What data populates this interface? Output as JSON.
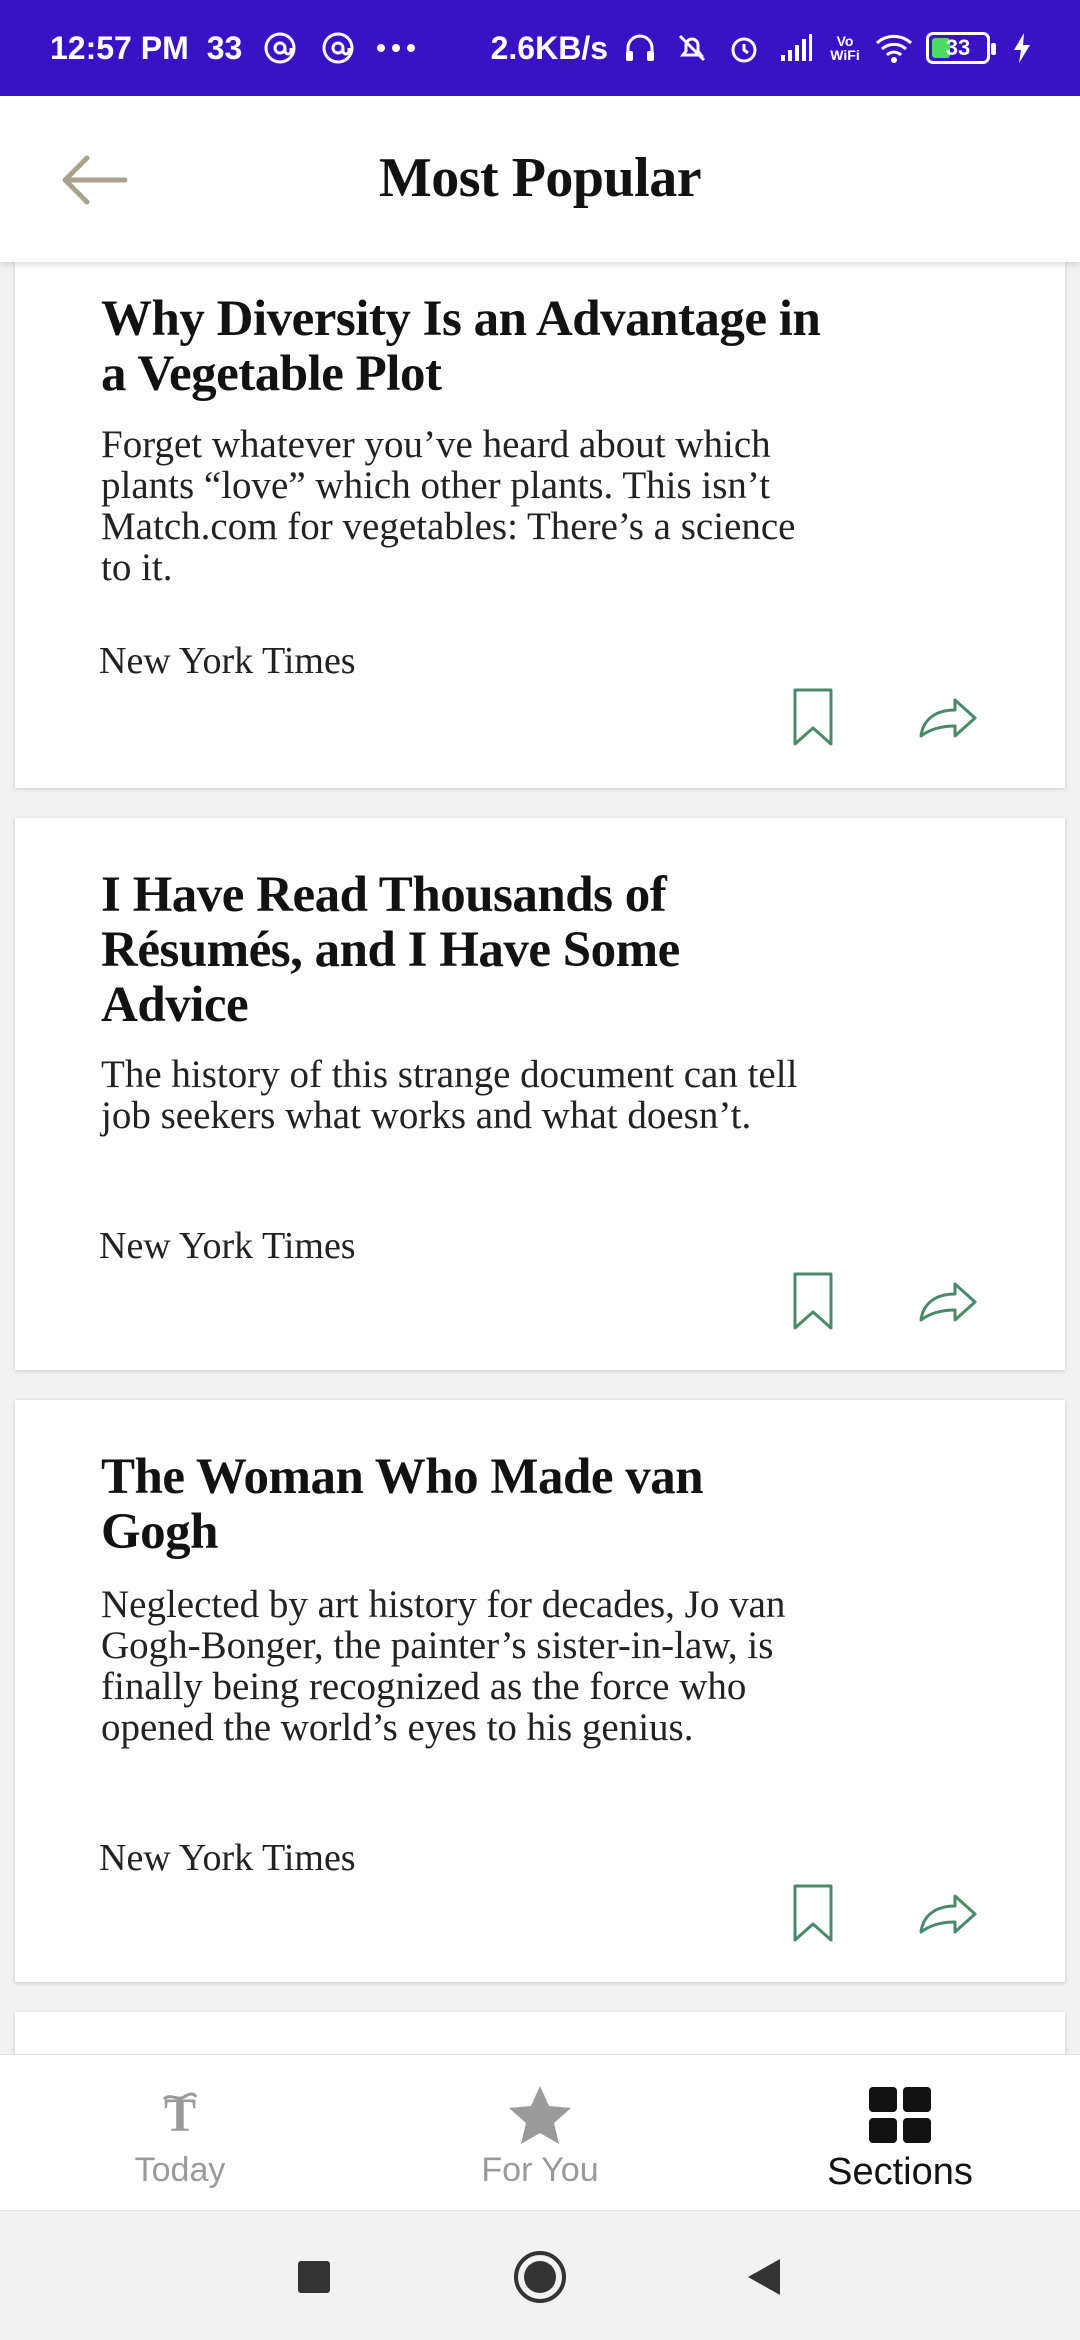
{
  "status_bar": {
    "time": "12:57 PM",
    "notif_count": "33",
    "speed": "2.6KB/s",
    "battery": "33",
    "icons": [
      "at-icon",
      "at-icon",
      "more-icon",
      "headphones-icon",
      "bell-off-icon",
      "alarm-icon",
      "signal-icon",
      "vowifi-icon",
      "wifi-icon",
      "battery-icon",
      "charging-icon"
    ],
    "vowifi_text": "Vo WiFi"
  },
  "app_bar": {
    "title": "Most Popular",
    "back_icon": "arrow-left-icon"
  },
  "articles": [
    {
      "title": "Why Diversity Is an Advantage in a Vegetable Plot",
      "summary": "Forget whatever you’ve heard about which plants “love” which other plants. This isn’t Match.com for vegetables: There’s a science to it.",
      "source": "New York Times"
    },
    {
      "title": "I Have Read Thousands of Résumés, and I Have Some Advice",
      "summary": "The history of this strange document can tell job seekers what works and what doesn’t.",
      "source": "New York Times"
    },
    {
      "title": "The Woman Who Made van Gogh",
      "summary": "Neglected by art history for decades, Jo van Gogh-Bonger, the painter’s sister-in-law, is finally being recognized as the force who opened the world’s eyes to his genius.",
      "source": "New York Times"
    }
  ],
  "bottom_nav": {
    "items": [
      {
        "label": "Today",
        "icon": "nyt-logo-icon",
        "active": false
      },
      {
        "label": "For You",
        "icon": "star-icon",
        "active": false
      },
      {
        "label": "Sections",
        "icon": "grid-icon",
        "active": true
      }
    ]
  },
  "colors": {
    "status_bar": "#3a12c6",
    "action_icon": "#4a8a6a",
    "inactive_nav": "#9a9a9a",
    "active_nav": "#121212"
  }
}
